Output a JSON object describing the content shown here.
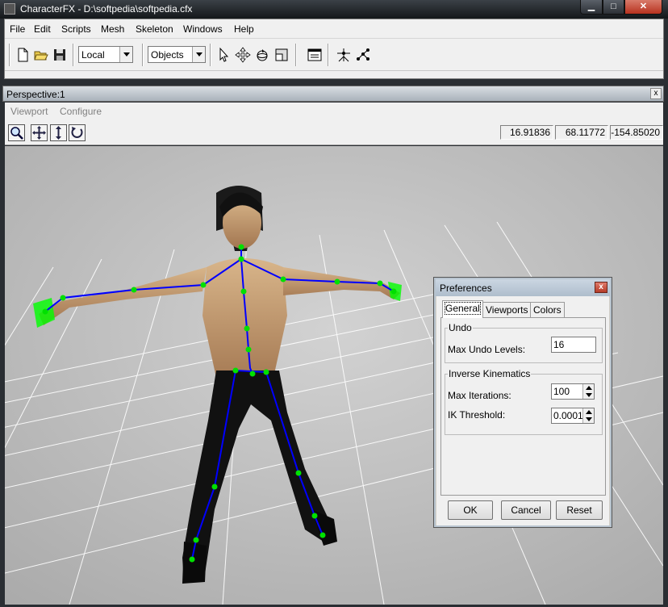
{
  "window": {
    "title": "CharacterFX - D:\\softpedia\\softpedia.cfx",
    "minimize_glyph": "▁",
    "maximize_glyph": "□",
    "close_glyph": "✕"
  },
  "menubar": {
    "items": [
      {
        "label": "File"
      },
      {
        "label": "Edit"
      },
      {
        "label": "Scripts"
      },
      {
        "label": "Mesh"
      },
      {
        "label": "Skeleton"
      },
      {
        "label": "Windows"
      },
      {
        "label": "Help"
      }
    ]
  },
  "toolbar": {
    "icons": [
      "new-file-icon",
      "open-folder-icon",
      "save-icon",
      "select-arrow-icon",
      "move-icon",
      "rotate-icon",
      "scale-icon",
      "viewport-icon",
      "bone-node-icon",
      "ik-chain-icon"
    ],
    "coord_space": "Local",
    "selection_mode": "Objects"
  },
  "child_window": {
    "title": "Perspective:1",
    "close_glyph": "x",
    "menu": [
      "Viewport",
      "Configure"
    ],
    "coords": [
      "16.91836",
      "68.11772",
      "-154.85020"
    ],
    "viewport_tools": [
      "zoom-icon",
      "pan-icon",
      "dolly-icon",
      "orbit-icon"
    ]
  },
  "scene": {
    "background": "#c3c3c3",
    "grid_color": "#ffffff",
    "bone_color": "#0000ff",
    "joint_color": "#00e000"
  },
  "preferences": {
    "title": "Preferences",
    "close_glyph": "x",
    "tabs": [
      "General",
      "Viewports",
      "Colors"
    ],
    "undo_group": "Undo",
    "max_undo_label": "Max Undo Levels:",
    "max_undo_value": "16",
    "ik_group": "Inverse Kinematics",
    "max_iterations_label": "Max Iterations:",
    "max_iterations_value": "100",
    "ik_threshold_label": "IK Threshold:",
    "ik_threshold_value": "0.0001",
    "buttons": {
      "ok": "OK",
      "cancel": "Cancel",
      "reset": "Reset"
    }
  }
}
